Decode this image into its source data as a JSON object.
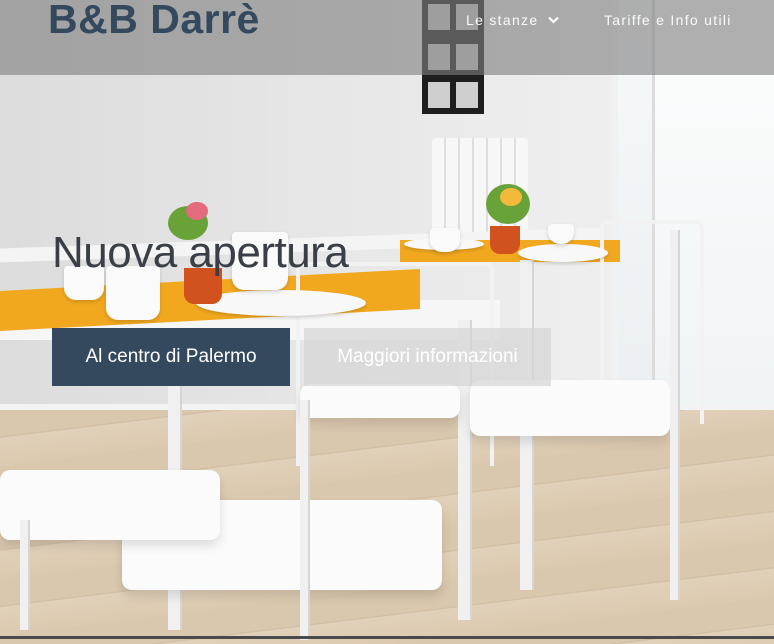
{
  "header": {
    "brand": "B&B Darrè",
    "nav": [
      {
        "label": "Le stanze",
        "has_dropdown": true,
        "icon": "chevron-down-icon"
      },
      {
        "label": "Tariffe e Info utili",
        "has_dropdown": false
      }
    ]
  },
  "hero": {
    "title": "Nuova apertura",
    "buttons": [
      {
        "label": "Al centro di Palermo"
      },
      {
        "label": "Maggiori informazioni"
      }
    ]
  },
  "colors": {
    "brand": "#34495e",
    "header_bg": "rgba(128,128,128,0.62)",
    "primary_button": "#34495e",
    "secondary_button": "rgba(214,214,214,0.72)",
    "accent_runner": "#f1a81f"
  }
}
